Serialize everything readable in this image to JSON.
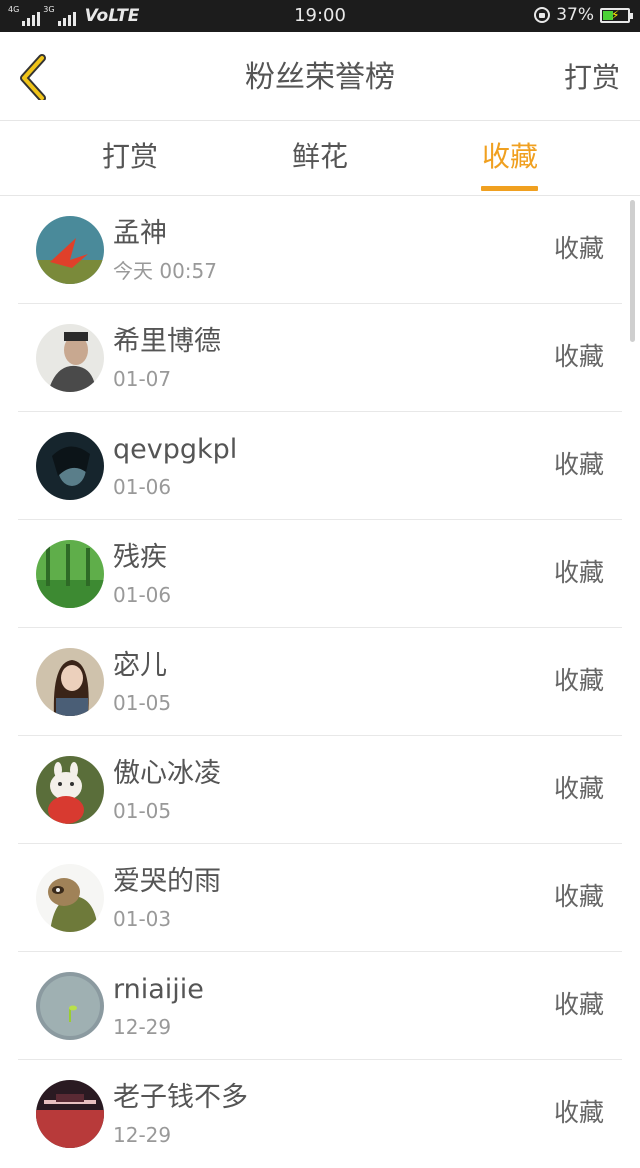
{
  "status_bar": {
    "net1": "4G",
    "net2": "3G",
    "volte": "VoLTE",
    "time": "19:00",
    "battery": "37%",
    "battery_level": 0.37
  },
  "header": {
    "title": "粉丝荣誉榜",
    "right_action": "打赏"
  },
  "tabs": [
    {
      "label": "打赏",
      "active": false
    },
    {
      "label": "鲜花",
      "active": false
    },
    {
      "label": "收藏",
      "active": true
    }
  ],
  "colors": {
    "accent": "#f0a020",
    "text": "#555555",
    "subtext": "#999999"
  },
  "list": [
    {
      "name": "孟神",
      "date": "今天 00:57",
      "action": "收藏"
    },
    {
      "name": "希里博德",
      "date": "01-07",
      "action": "收藏"
    },
    {
      "name": "qevpgkpl",
      "date": "01-06",
      "action": "收藏"
    },
    {
      "name": "残疾",
      "date": "01-06",
      "action": "收藏"
    },
    {
      "name": "宓儿",
      "date": "01-05",
      "action": "收藏"
    },
    {
      "name": "傲心冰凌",
      "date": "01-05",
      "action": "收藏"
    },
    {
      "name": "爱哭的雨",
      "date": "01-03",
      "action": "收藏"
    },
    {
      "name": "rniaijie",
      "date": "12-29",
      "action": "收藏"
    },
    {
      "name": "老子钱不多",
      "date": "12-29",
      "action": "收藏"
    }
  ]
}
